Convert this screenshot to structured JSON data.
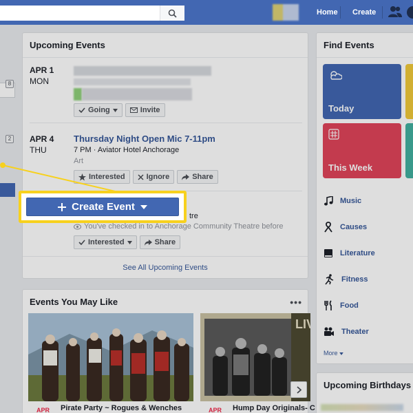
{
  "header": {
    "nav_home": "Home",
    "nav_create": "Create",
    "icons": [
      "search-icon",
      "friends-icon",
      "globe-icon"
    ]
  },
  "left_rail": {
    "badge_top": "8",
    "badge_bottom": "2"
  },
  "upcoming_events": {
    "title": "Upcoming Events",
    "events": [
      {
        "date": "APR 1",
        "day": "MON",
        "buttons": [
          "Going",
          "Invite"
        ]
      },
      {
        "date": "APR 4",
        "day": "THU",
        "title": "Thursday Night Open Mic 7-11pm",
        "meta": "7 PM · Aviator Hotel Anchorage",
        "category": "Art",
        "buttons": [
          "Interested",
          "Ignore",
          "Share"
        ]
      },
      {
        "location_tail": "tre",
        "checkin": "You've checked in to Anchorage Community Theatre before",
        "buttons": [
          "Interested",
          "Share"
        ]
      }
    ],
    "see_all": "See All Upcoming Events"
  },
  "create_event": {
    "label": "Create Event"
  },
  "events_you_may_like": {
    "title": "Events You May Like",
    "more": "•••",
    "items": [
      {
        "date": "APR",
        "title": "Pirate Party ~ Rogues & Wenches"
      },
      {
        "date": "APR",
        "title": "Hump Day Originals- C"
      }
    ],
    "photo_text": "LIV"
  },
  "find_events": {
    "title": "Find Events",
    "tiles": [
      {
        "label": "Today",
        "color": "#4267b2"
      },
      {
        "label": "This Week",
        "color": "#e0445a"
      }
    ],
    "categories": [
      {
        "label": "Music",
        "icon": "music-note-icon"
      },
      {
        "label": "Causes",
        "icon": "ribbon-icon"
      },
      {
        "label": "Literature",
        "icon": "book-icon"
      },
      {
        "label": "Fitness",
        "icon": "running-icon"
      },
      {
        "label": "Food",
        "icon": "fork-knife-icon"
      },
      {
        "label": "Theater",
        "icon": "film-camera-icon"
      }
    ],
    "more": "More"
  },
  "birthdays": {
    "title": "Upcoming Birthdays"
  },
  "colors": {
    "brand": "#4267b2",
    "link": "#365899",
    "highlight": "#f7d11e"
  }
}
